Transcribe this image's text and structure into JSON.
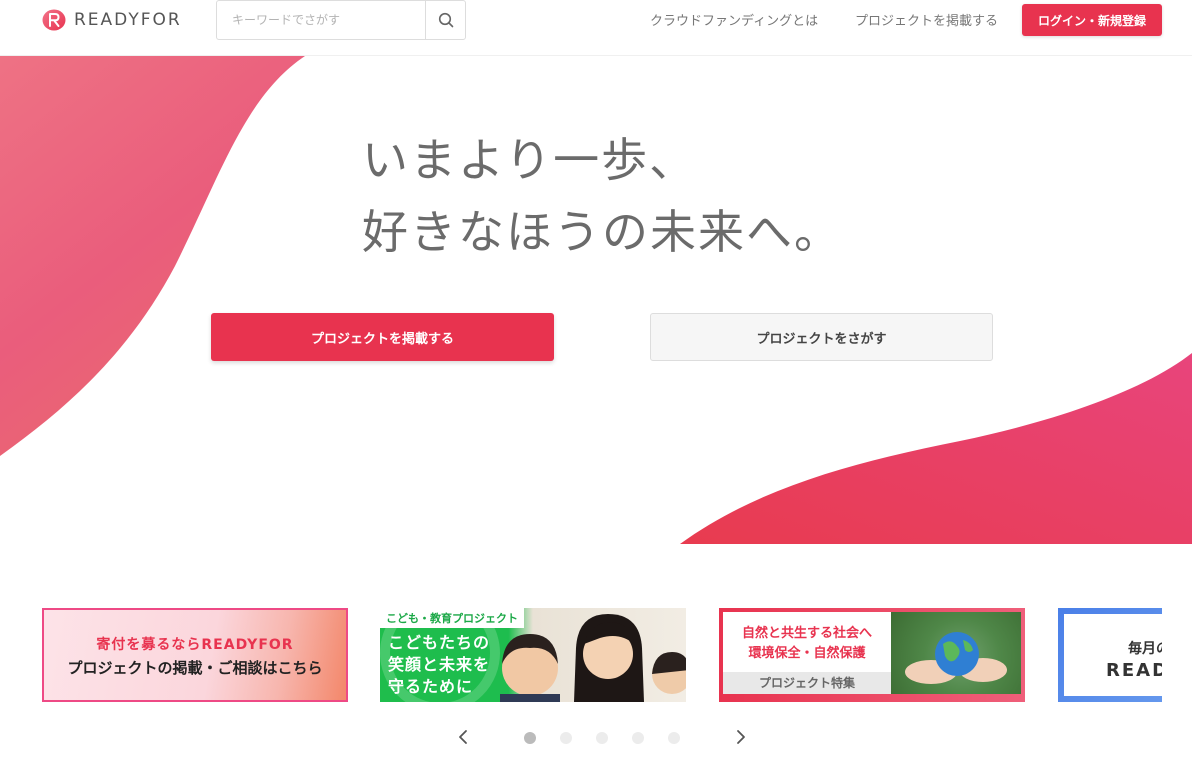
{
  "header": {
    "logo_text": "READYFOR",
    "search_placeholder": "キーワードでさがす",
    "nav": [
      {
        "label": "クラウドファンディングとは"
      },
      {
        "label": "プロジェクトを掲載する"
      }
    ],
    "login_label": "ログイン・新規登録"
  },
  "hero": {
    "headline_line1": "いまより一歩、",
    "headline_line2": "好きなほうの未来へ。",
    "primary_cta": "プロジェクトを掲載する",
    "secondary_cta": "プロジェクトをさがす"
  },
  "banners": [
    {
      "line1": "寄付を募るならREADYFOR",
      "line2": "プロジェクトの掲載・ご相談はこちら"
    },
    {
      "tag": "こども・教育プロジェクト",
      "line1": "こどもたちの",
      "line2": "笑顔と未来を",
      "line3": "守るために"
    },
    {
      "line1": "自然と共生する社会へ",
      "line2": "環境保全・自然保護",
      "line3": "プロジェクト特集"
    },
    {
      "line1": "毎月の",
      "line2": "READ"
    }
  ],
  "carousel": {
    "dot_count": 5,
    "active_index": 0
  },
  "colors": {
    "brand": "#e8334f",
    "hero_gradient_start": "#ec6a7c",
    "hero_gradient_end": "#e8334f"
  }
}
